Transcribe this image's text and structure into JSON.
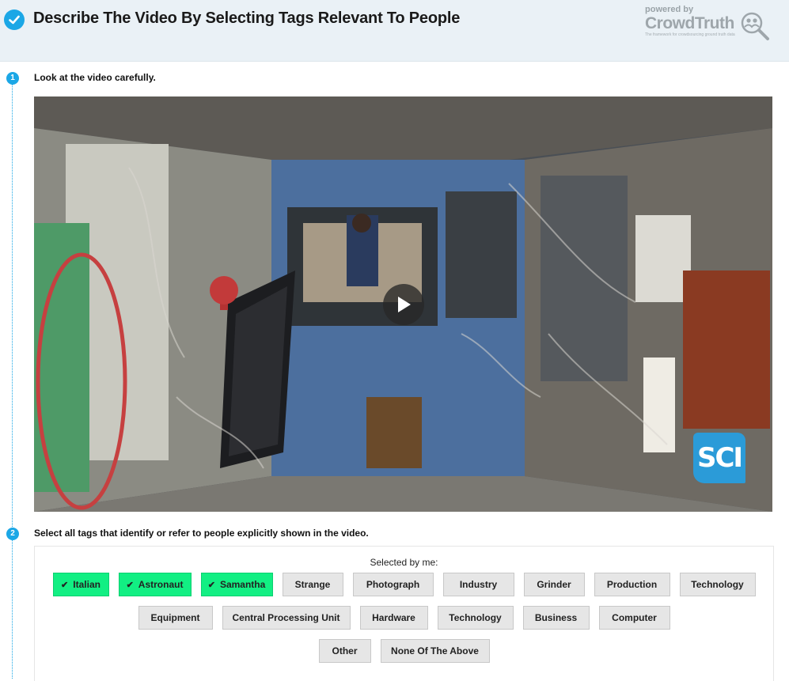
{
  "header": {
    "title": "Describe The Video By Selecting Tags Relevant To People",
    "brand_powered": "powered by",
    "brand_name": "CrowdTruth",
    "brand_tagline": "The framework for crowdsourcing ground truth data"
  },
  "colors": {
    "accent": "#1ba7e6",
    "selected_tag": "#12ef83",
    "tag_bg": "#e6e6e6",
    "header_bg": "#eaf1f6"
  },
  "steps": [
    {
      "number": "1",
      "text": "Look at the video carefully."
    },
    {
      "number": "2",
      "text": "Select all tags that identify or refer to people explicitly shown in the video."
    }
  ],
  "video": {
    "overlay_logo": "SCI",
    "play_icon": "play-icon"
  },
  "tags": {
    "selected_label": "Selected by me:",
    "rows": [
      [
        {
          "label": "Italian",
          "selected": true
        },
        {
          "label": "Astronaut",
          "selected": true
        },
        {
          "label": "Samantha",
          "selected": true
        },
        {
          "label": "Strange",
          "selected": false
        },
        {
          "label": "Photograph",
          "selected": false
        },
        {
          "label": "Industry",
          "selected": false
        },
        {
          "label": "Grinder",
          "selected": false
        },
        {
          "label": "Production",
          "selected": false
        },
        {
          "label": "Technology",
          "selected": false
        }
      ],
      [
        {
          "label": "Equipment",
          "selected": false
        },
        {
          "label": "Central Processing Unit",
          "selected": false
        },
        {
          "label": "Hardware",
          "selected": false
        },
        {
          "label": "Technology",
          "selected": false
        },
        {
          "label": "Business",
          "selected": false
        },
        {
          "label": "Computer",
          "selected": false
        }
      ],
      [
        {
          "label": "Other",
          "selected": false
        },
        {
          "label": "None Of The Above",
          "selected": false
        }
      ]
    ]
  }
}
